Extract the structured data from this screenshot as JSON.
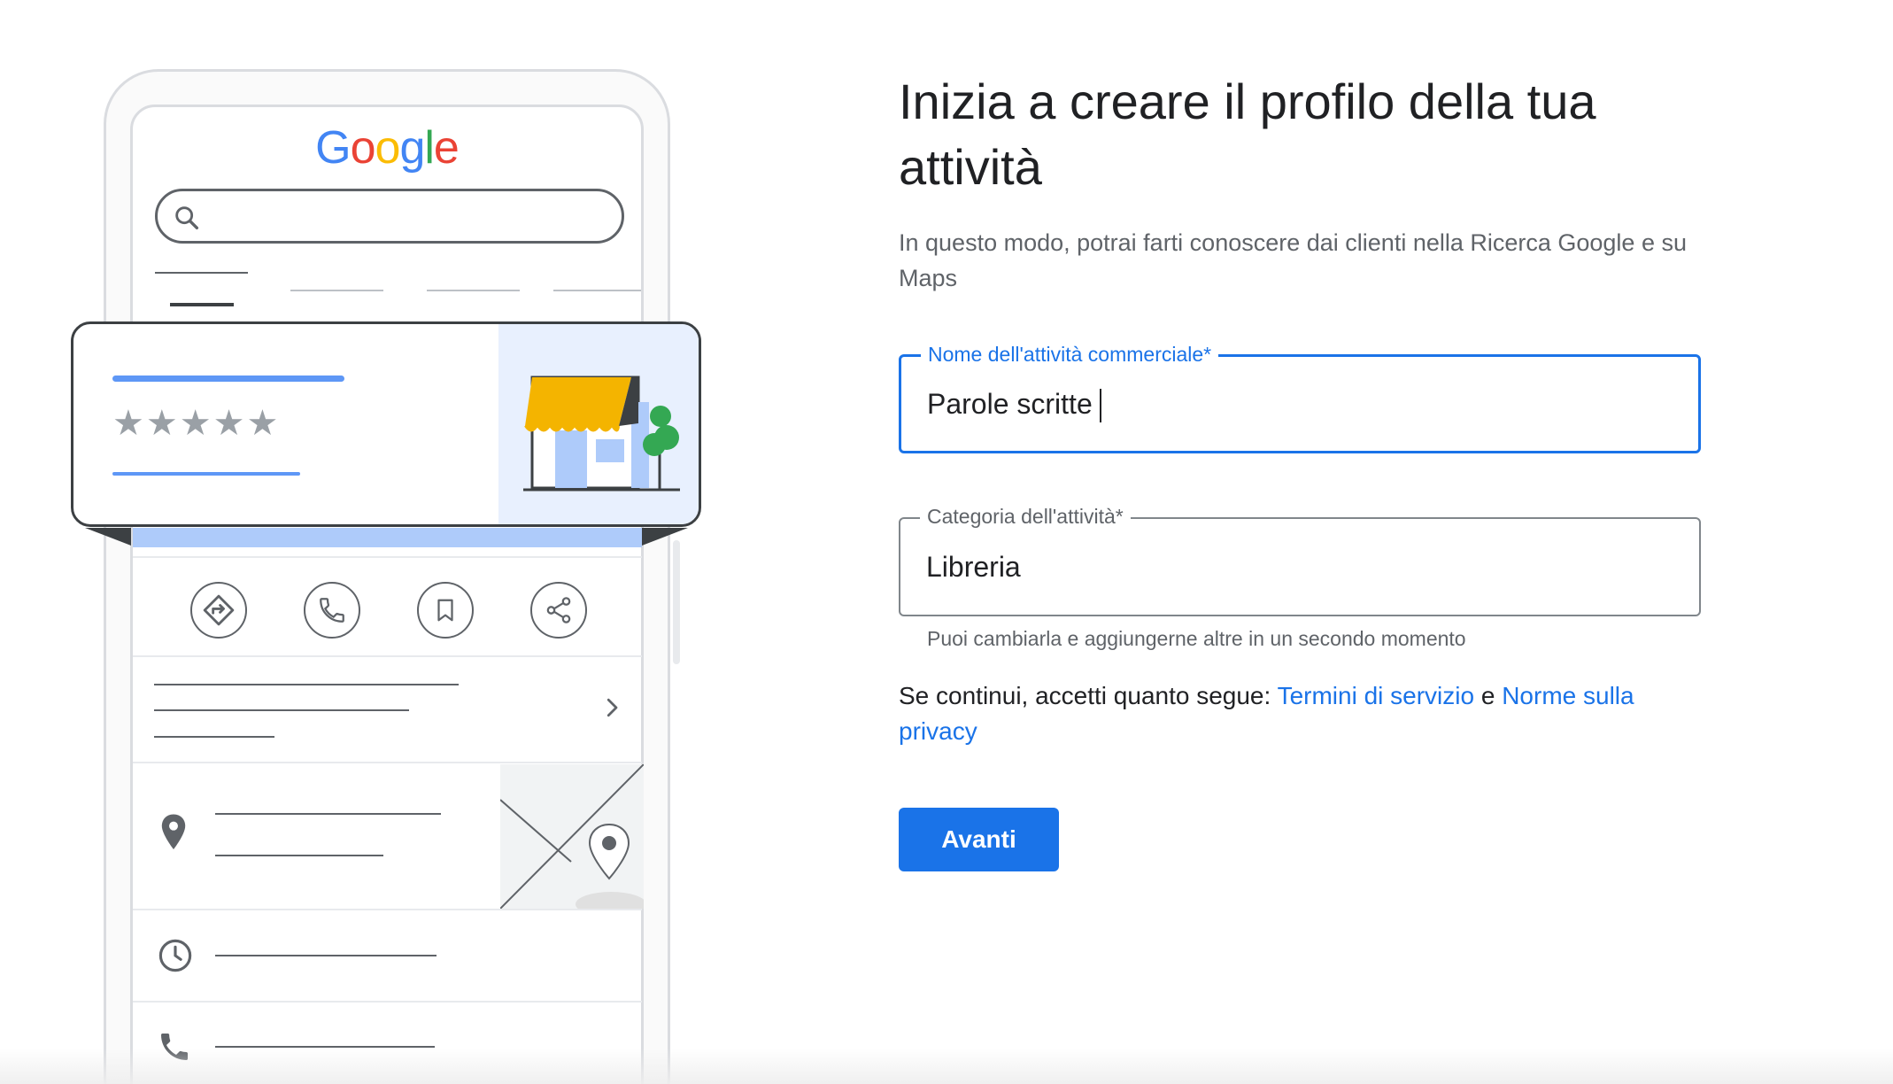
{
  "illustration": {
    "logo": {
      "G": "G",
      "o1": "o",
      "o2": "o",
      "g": "g",
      "l": "l",
      "e": "e"
    },
    "rating_stars": "★★★★★",
    "card_store_colors": {
      "awning": "#f4b400",
      "tree": "#34a853",
      "window": "#aecbfa"
    }
  },
  "form": {
    "title": "Inizia a creare il profilo della tua attività",
    "subtitle": "In questo modo, potrai farti conoscere dai clienti nella Ricerca Google e su Maps",
    "business_name": {
      "label": "Nome dell'attività commerciale*",
      "value": "Parole scritte"
    },
    "business_category": {
      "label": "Categoria dell'attività*",
      "value": "Libreria",
      "helper": "Puoi cambiarla e aggiungerne altre in un secondo momento"
    },
    "terms": {
      "prefix": "Se continui, accetti quanto segue: ",
      "tos_link": "Termini di servizio",
      "conjunction": " e ",
      "privacy_link": "Norme sulla privacy"
    },
    "next_button": "Avanti"
  },
  "colors": {
    "primary": "#1a73e8",
    "text": "#202124",
    "secondary_text": "#5f6368"
  }
}
